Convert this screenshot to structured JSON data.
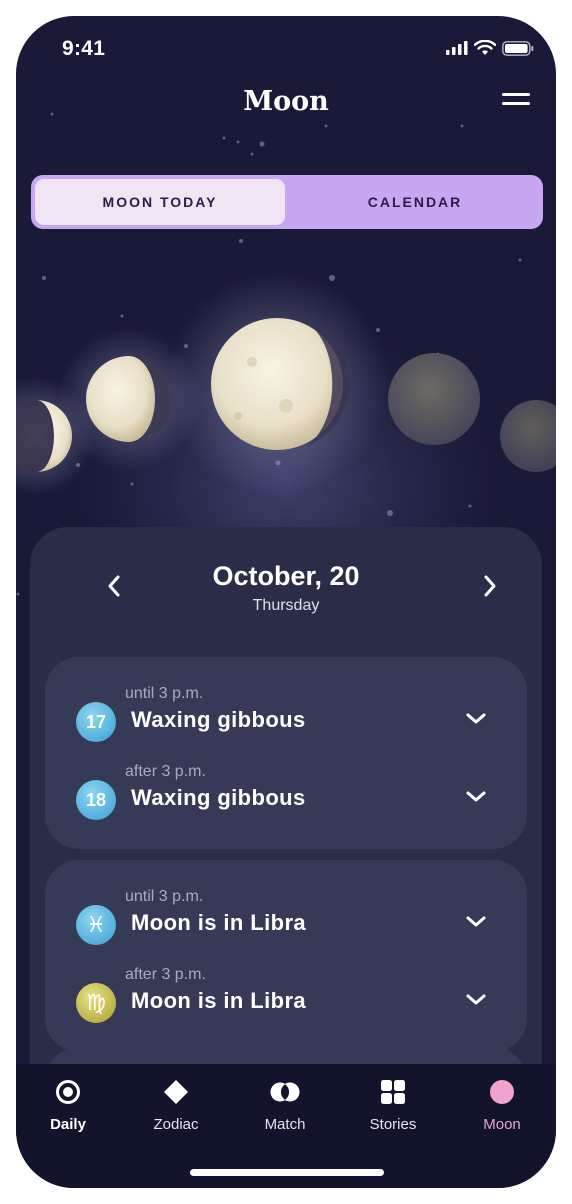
{
  "status_bar": {
    "time": "9:41"
  },
  "header": {
    "title": "Moon"
  },
  "segments": {
    "active": "MOON TODAY",
    "other": "CALENDAR"
  },
  "colors": {
    "background": "#191a38",
    "accent": "#c7a6f2",
    "active_tab": "#f0a2cc",
    "card": "#2a2d47"
  },
  "date": {
    "main": "October, 20",
    "weekday": "Thursday"
  },
  "phase_rows": [
    {
      "when": "until 3 p.m.",
      "day": "17",
      "label": "Waxing gibbous"
    },
    {
      "when": "after 3 p.m.",
      "day": "18",
      "label": "Waxing gibbous"
    }
  ],
  "sign_rows": [
    {
      "when": "until 3 p.m.",
      "sign_icon": "pisces-icon",
      "glyph": "♓",
      "label": "Moon is in Libra"
    },
    {
      "when": "after 3 p.m.",
      "sign_icon": "virgo-icon",
      "glyph": "♍",
      "label": "Moon is in Libra"
    }
  ],
  "tabbar": [
    {
      "label": "Daily",
      "icon": "daily-icon"
    },
    {
      "label": "Zodiac",
      "icon": "zodiac-icon"
    },
    {
      "label": "Match",
      "icon": "match-icon"
    },
    {
      "label": "Stories",
      "icon": "stories-icon"
    },
    {
      "label": "Moon",
      "icon": "moon-icon"
    }
  ]
}
